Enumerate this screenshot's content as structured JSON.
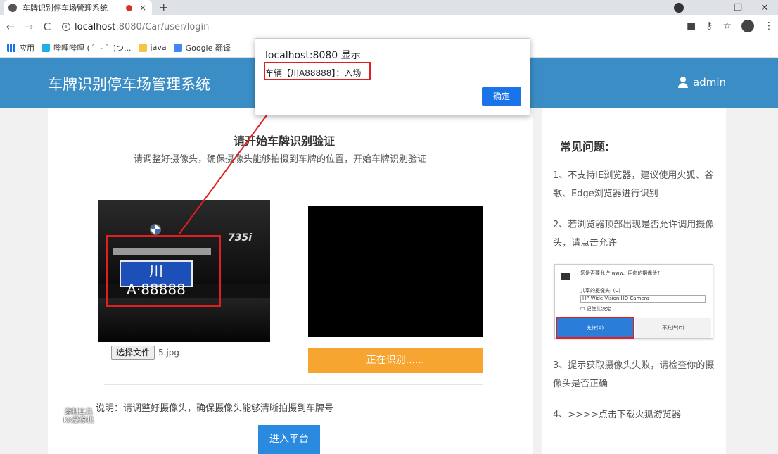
{
  "browser": {
    "tab_title": "车牌识别停车场管理系统",
    "tab_close": "×",
    "new_tab": "+",
    "url_host": "localhost",
    "url_path": ":8080/Car/user/login",
    "bookmarks": [
      "应用",
      "哔哩哔哩 ( ゜- ゜)つ...",
      "java",
      "Google 翻译"
    ]
  },
  "header": {
    "title": "车牌识别停车场管理系统",
    "username": "admin"
  },
  "main": {
    "title": "请开始车牌识别验证",
    "subtitle": "请调整好摄像头，确保摄像头能够拍摄到车牌的位置，开始车牌识别验证",
    "plate_text": "川A·88888",
    "plate_sub": "BMW",
    "car_model": "735i",
    "file_button": "选择文件",
    "file_name": "5.jpg",
    "recognizing_button": "正在识别......",
    "note": "说明：请调整好摄像头，确保摄像头能够清晰拍摄到车牌号",
    "enter_button": "进入平台",
    "watermark_line1": "录制工具",
    "watermark_line2": "KK录像机"
  },
  "sidebar": {
    "title": "常见问题:",
    "q1": "1、不支持IE浏览器，建议使用火狐、谷歌、Edge浏览器进行识别",
    "q2": "2、若浏览器顶部出现是否允许调用摄像头，请点击允许",
    "q3": "3、提示获取摄像头失败，请检查你的摄像头是否正确",
    "q4": "4、>>>>点击下载火狐游览器",
    "perm_question": "您是否要允许 www.                    .用你的摄像头?",
    "perm_shared": "共享的摄像头: (C)",
    "perm_camera": "HP Wide Vision HD Camera",
    "perm_remember": "记住此决定",
    "perm_allow": "允许(A)",
    "perm_deny": "不允许(D)"
  },
  "alert": {
    "title": "localhost:8080 显示",
    "message": "车辆【川A88888】：入场",
    "ok": "确定"
  },
  "colors": {
    "header_bg": "#3a8dc5",
    "orange_button": "#f6a531",
    "blue_button": "#2a8ae0",
    "highlight_red": "#e02020"
  }
}
